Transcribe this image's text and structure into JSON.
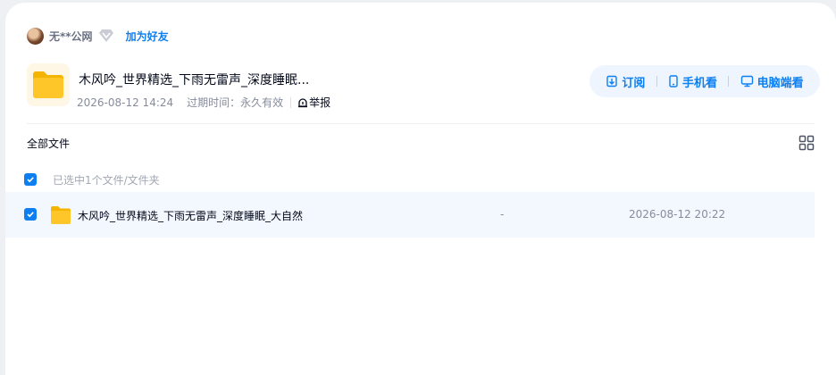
{
  "user": {
    "name": "无**公网",
    "add_friend": "加为好友"
  },
  "share": {
    "title": "木风吟_世界精选_下雨无雷声_深度睡眠...",
    "date": "2026-08-12 14:24",
    "expire_label": "过期时间：",
    "expire_value": "永久有效",
    "report": "举报"
  },
  "actions": {
    "subscribe": "订阅",
    "phone": "手机看",
    "pc": "电脑端看"
  },
  "list": {
    "breadcrumb": "全部文件",
    "selected_text": "已选中1个文件/文件夹",
    "files": [
      {
        "name": "木风吟_世界精选_下雨无雷声_深度睡眠_大自然",
        "size": "-",
        "date": "2026-08-12 20:22"
      }
    ]
  },
  "colors": {
    "accent": "#0d7ff0",
    "selected_row": "#f3f8fe",
    "folder": "#ffc629"
  },
  "icons": {
    "vip": "diamond-icon",
    "folder": "folder-icon",
    "report": "report-icon",
    "subscribe": "subscribe-icon",
    "phone": "phone-icon",
    "pc": "monitor-icon",
    "grid": "grid-view-icon",
    "check": "check-icon"
  }
}
